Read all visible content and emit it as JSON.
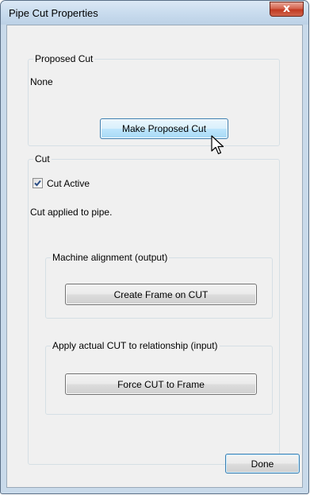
{
  "window": {
    "title": "Pipe Cut Properties",
    "close_symbol": "x"
  },
  "proposed_cut": {
    "legend": "Proposed Cut",
    "value": "None",
    "make_button": "Make Proposed Cut"
  },
  "cut": {
    "legend": "Cut",
    "active_label": "Cut Active",
    "active_checked": true,
    "status": "Cut applied to pipe.",
    "machine_alignment": {
      "legend": "Machine alignment (output)",
      "button": "Create Frame on CUT"
    },
    "apply_actual": {
      "legend": "Apply actual CUT to relationship (input)",
      "button": "Force CUT to Frame"
    }
  },
  "footer": {
    "done_button": "Done"
  },
  "colors": {
    "close_button": "#c13a21",
    "hot_button": "#bee6fd",
    "check_mark": "#2a4e86"
  },
  "icons": {
    "close": "close-icon",
    "check": "checkmark-icon",
    "cursor": "mouse-pointer-icon"
  }
}
